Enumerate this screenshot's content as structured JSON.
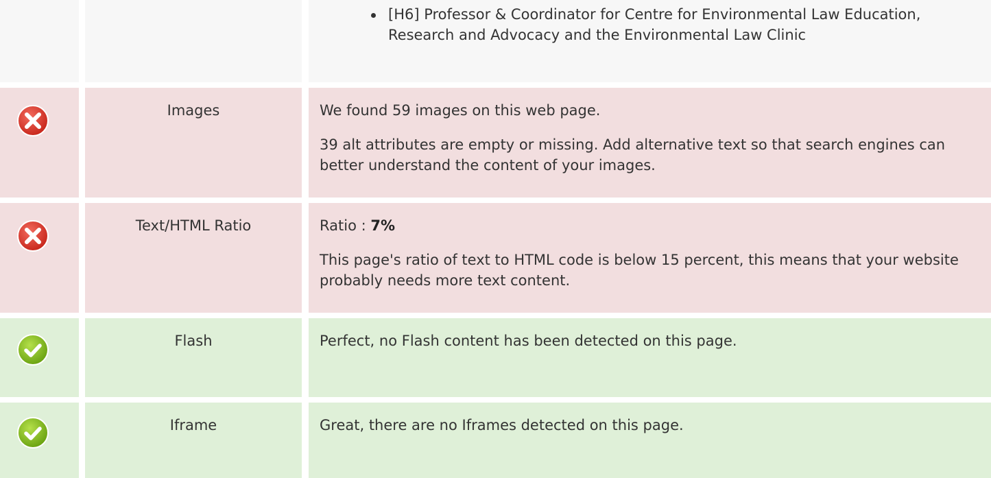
{
  "rows": [
    {
      "kind": "neutral",
      "status": "",
      "label": "",
      "bullets": [
        "[H6] Professor & Coordinator for Centre for Environmental Law Education, Research and Advocacy and the Environmental Law Clinic"
      ]
    },
    {
      "kind": "bad",
      "status": "error-icon",
      "label": "Images",
      "p1": "We found 59 images on this web page.",
      "p2": "39 alt attributes are empty or missing. Add alternative text so that search engines can better understand the content of your images."
    },
    {
      "kind": "bad",
      "status": "error-icon",
      "label": "Text/HTML Ratio",
      "p1_prefix": "Ratio : ",
      "p1_value": "7%",
      "p2": "This page's ratio of text to HTML code is below 15 percent, this means that your website probably needs more text content."
    },
    {
      "kind": "good",
      "status": "check-icon",
      "label": "Flash",
      "p1": "Perfect, no Flash content has been detected on this page."
    },
    {
      "kind": "good",
      "status": "check-icon",
      "label": "Iframe",
      "p1": "Great, there are no Iframes detected on this page."
    }
  ],
  "colors": {
    "neutral_bg": "#f7f7f7",
    "error_bg": "#f2dedf",
    "success_bg": "#dff0d8",
    "error_icon": "#d9362b",
    "success_icon": "#7cb518"
  }
}
